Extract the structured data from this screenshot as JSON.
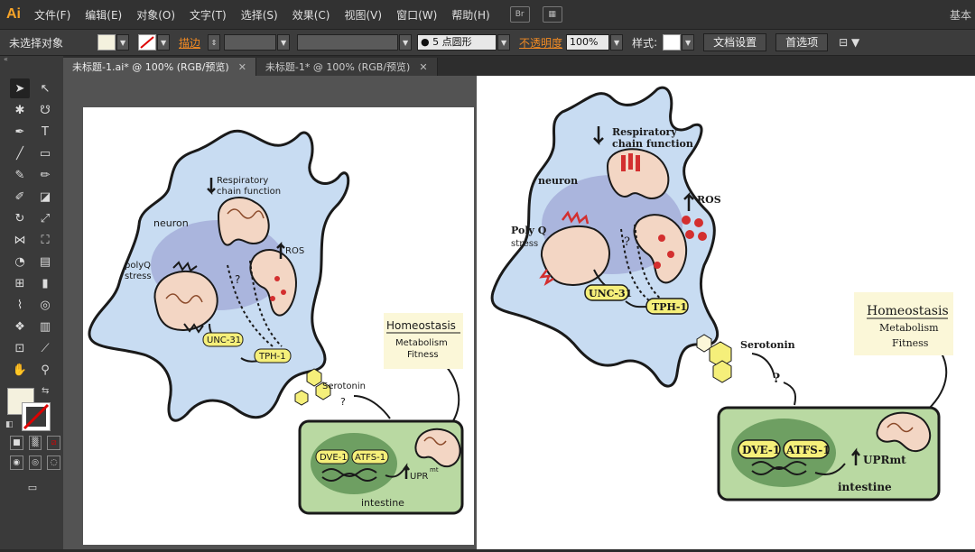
{
  "app": {
    "logo": "Ai",
    "workspace": "基本"
  },
  "menu": [
    "文件(F)",
    "编辑(E)",
    "对象(O)",
    "文字(T)",
    "选择(S)",
    "效果(C)",
    "视图(V)",
    "窗口(W)",
    "帮助(H)"
  ],
  "control_bar": {
    "selection_status": "未选择对象",
    "stroke_label": "描边",
    "brush_value": "5 点圆形",
    "opacity_label": "不透明度",
    "opacity_value": "100%",
    "style_label": "样式",
    "doc_setup_button": "文档设置",
    "preferences_button": "首选项"
  },
  "tabs": [
    {
      "label": "未标题-1.ai* @ 100% (RGB/预览)"
    },
    {
      "label": "未标题-1* @ 100% (RGB/预览)"
    }
  ],
  "colors": {
    "neuron_fill": "#c8dcf2",
    "nucleus_fill": "#aab5dd",
    "mito_fill": "#f3d6c4",
    "label_yellow": "#f5ef7a",
    "intestine_fill": "#b9d9a2",
    "homeostasis_fill": "#fbf7d8"
  },
  "diagram_left": {
    "respiratory": "Respiratory",
    "chain": "chain function",
    "neuron": "neuron",
    "polyq": "polyQ",
    "stress": "stress",
    "ros": "ROS",
    "question1": "?",
    "unc31": "UNC-31",
    "tph1": "TPH-1",
    "serotonin": "Serotonin",
    "question2": "?",
    "homeostasis": "Homeostasis",
    "metabolism": "Metabolism",
    "fitness": "Fitness",
    "dve1": "DVE-1",
    "atfs1": "ATFS-1",
    "upr": "UPR",
    "upr_sup": "mt",
    "intestine": "intestine"
  },
  "diagram_right": {
    "respiratory": "Respiratory",
    "chain": "chain function",
    "neuron": "neuron",
    "polyq": "Poly Q",
    "stress": "stress",
    "ros": "ROS",
    "question1": "?",
    "unc31": "UNC-31",
    "tph1": "TPH-1",
    "serotonin": "Serotonin",
    "question2": "?",
    "homeostasis": "Homeostasis",
    "metabolism": "Metabolism",
    "fitness": "Fitness",
    "dve1": "DVE-1",
    "atfs1": "ATFS-1",
    "upr": "UPRmt",
    "intestine": "intestine"
  }
}
